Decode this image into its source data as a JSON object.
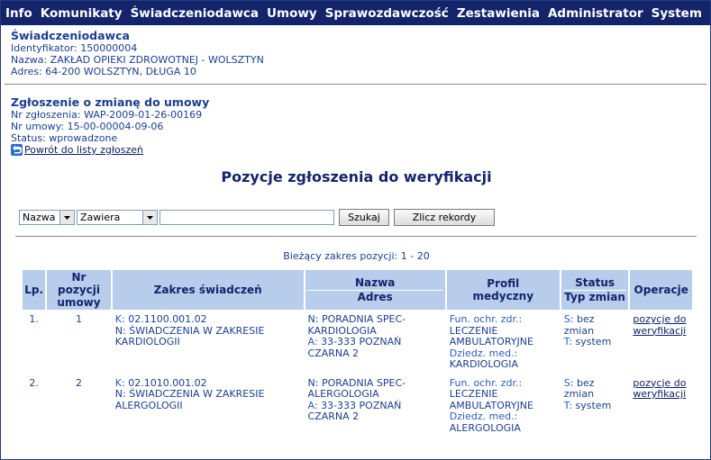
{
  "menu": [
    "Info",
    "Komunikaty",
    "Świadczeniodawca",
    "Umowy",
    "Sprawozdawczość",
    "Zestawienia",
    "Administrator",
    "System"
  ],
  "provider": {
    "heading": "Świadczeniodawca",
    "id_line": "Identyfikator: 150000004",
    "name_line": "Nazwa: ZAKŁAD OPIEKI ZDROWOTNEJ - WOLSZTYN",
    "address_line": "Adres: 64-200 WOLSZTYN, DŁUGA 10"
  },
  "request": {
    "heading": "Zgłoszenie o zmianę do umowy",
    "number_line": "Nr zgłoszenia: WAP-2009-01-26-00169",
    "contract_line": "Nr umowy: 15-00-00004-09-06",
    "status_line": "Status: wprowadzone",
    "back_link": "Powrót do listy zgłoszeń"
  },
  "page_title": "Pozycje zgłoszenia do weryfikacji",
  "filters": {
    "field": "Nazwa",
    "operator": "Zawiera",
    "value": "",
    "search_label": "Szukaj",
    "count_label": "Zlicz rekordy"
  },
  "range_text": "Bieżący zakres pozycji: 1 - 20",
  "table": {
    "headers": {
      "lp": "Lp.",
      "nr_line1": "Nr pozycji",
      "nr_line2": "umowy",
      "zakres": "Zakres świadczeń",
      "nazwa": "Nazwa",
      "adres": "Adres",
      "profil_line1": "Profil",
      "profil_line2": "medyczny",
      "status": "Status",
      "typ": "Typ zmian",
      "operacje": "Operacje"
    },
    "rows": [
      {
        "lp": "1.",
        "nr": "1",
        "k_label": "K:",
        "k_value": "02.1100.001.02",
        "n_label": "N:",
        "n_value": "ŚWIADCZENIA W ZAKRESIE KARDIOLOGII",
        "name_label": "N:",
        "name_value": "PORADNIA SPEC-KARDIOLOGIA",
        "addr_label": "A:",
        "addr_value": "33-333 POZNAŃ CZARNA 2",
        "fun_label": "Fun. ochr. zdr.:",
        "fun_value": "LECZENIE AMBULATORYJNE",
        "dzied_label": "Dziedz. med.:",
        "dzied_value": "KARDIOLOGIA",
        "s_label": "S:",
        "s_value": "bez zmian",
        "t_label": "T:",
        "t_value": "system",
        "op_label": "pozycje do weryfikacji"
      },
      {
        "lp": "2.",
        "nr": "2",
        "k_label": "K:",
        "k_value": "02.1010.001.02",
        "n_label": "N:",
        "n_value": "ŚWIADCZENIA W ZAKRESIE ALERGOLOGII",
        "name_label": "N:",
        "name_value": "PORADNIA SPEC-ALERGOLOGIA",
        "addr_label": "A:",
        "addr_value": "33-333 POZNAŃ CZARNA 2",
        "fun_label": "Fun. ochr. zdr.:",
        "fun_value": "LECZENIE AMBULATORYJNE",
        "dzied_label": "Dziedz. med.:",
        "dzied_value": "ALERGOLOGIA",
        "s_label": "S:",
        "s_value": "bez zmian",
        "t_label": "T:",
        "t_value": "system",
        "op_label": "pozycje do weryfikacji"
      }
    ]
  },
  "colors": {
    "menubar": "#13246b",
    "text": "#1b3f8f",
    "header_cell": "#b8cceb",
    "link": "#0d1f66"
  }
}
